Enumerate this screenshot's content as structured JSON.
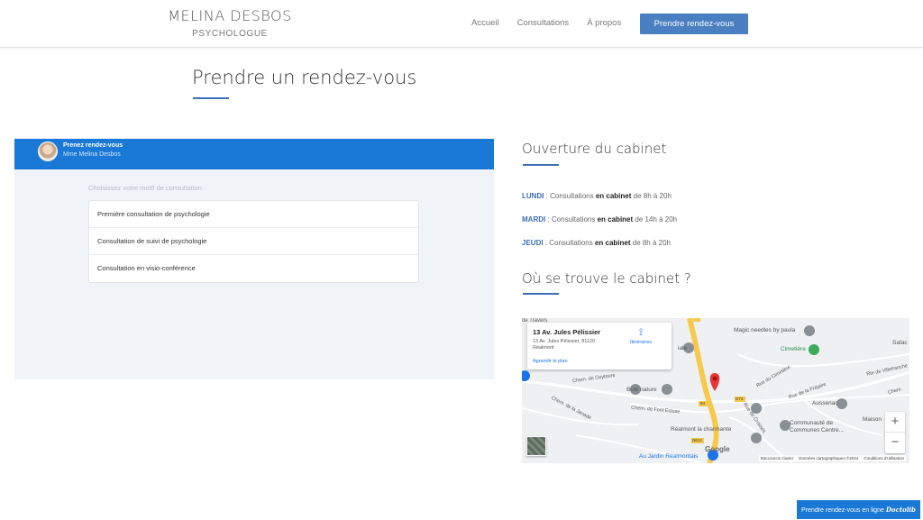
{
  "header": {
    "brand_name": "MELINA DESBOS",
    "brand_sub": "PSYCHOLOGUE",
    "nav": [
      "Accueil",
      "Consultations",
      "À propos"
    ],
    "cta": "Prendre rendez-vous"
  },
  "page_title": "Prendre un rendez-vous",
  "widget": {
    "title": "Prenez rendez-vous",
    "subtitle": "Mme Melina Desbos",
    "choose_label": "Choisissez votre motif de consultation",
    "motifs": [
      "Première consultation de psychologie",
      "Consultation de suivi de psychologie",
      "Consultation en visio-conférence"
    ]
  },
  "hours_section": {
    "title": "Ouverture du cabinet",
    "rows": [
      {
        "day": "LUNDI",
        "pre": " : Consultations ",
        "bold": "en cabinet",
        "post": " de 8h à 20h"
      },
      {
        "day": "MARDI",
        "pre": " : Consultations ",
        "bold": "en cabinet",
        "post": " de 14h à 20h"
      },
      {
        "day": "JEUDI",
        "pre": " : Consultations ",
        "bold": "en cabinet",
        "post": " de 8h à 20h"
      }
    ]
  },
  "location_section": {
    "title": "Où se trouve le cabinet ?"
  },
  "map": {
    "card_title": "13 Av. Jules Pélissier",
    "card_address": "13 Av. Jules Pélissier, 81120 Réalmont",
    "itinerary": "Itinéraires",
    "enlarge": "Agrandir le plan",
    "labels": {
      "magic": "Magic needles by paula",
      "cimetiere": "Cimetière",
      "bote": "Boté nature",
      "aussenac": "Aussenac",
      "communaute": "Communauté de Communes Centre...",
      "realmont": "Réalmont la charmante",
      "jardin": "Au Jardin Réalmontais",
      "maison": "Maison",
      "chem_ceytoure": "Chem. de Ceytoure",
      "chem_janade": "Chem. de la Janade",
      "chem_font": "Chem. de Font Ecluse",
      "rte_villefranche": "Rte de Villefranche",
      "rue_cimetiere": "Rue du Cimetière",
      "rue_frejaire": "Rue de la Fréjaire",
      "safac": "Safac",
      "chem": "Chem.",
      "rue_crosses": "Rue de Crosses",
      "ale": "iale",
      "c_travers": "de Travers"
    },
    "road_badges": [
      "D74",
      "84",
      "D612"
    ],
    "zoom_in": "+",
    "zoom_out": "−",
    "google": "Google",
    "footer": [
      "Raccourcis clavier",
      "Données cartographiques ©2024",
      "Conditions d'utilisation"
    ]
  },
  "doctolib": {
    "text": "Prendre rendez-vous en ligne",
    "logo": "Doctolib"
  }
}
